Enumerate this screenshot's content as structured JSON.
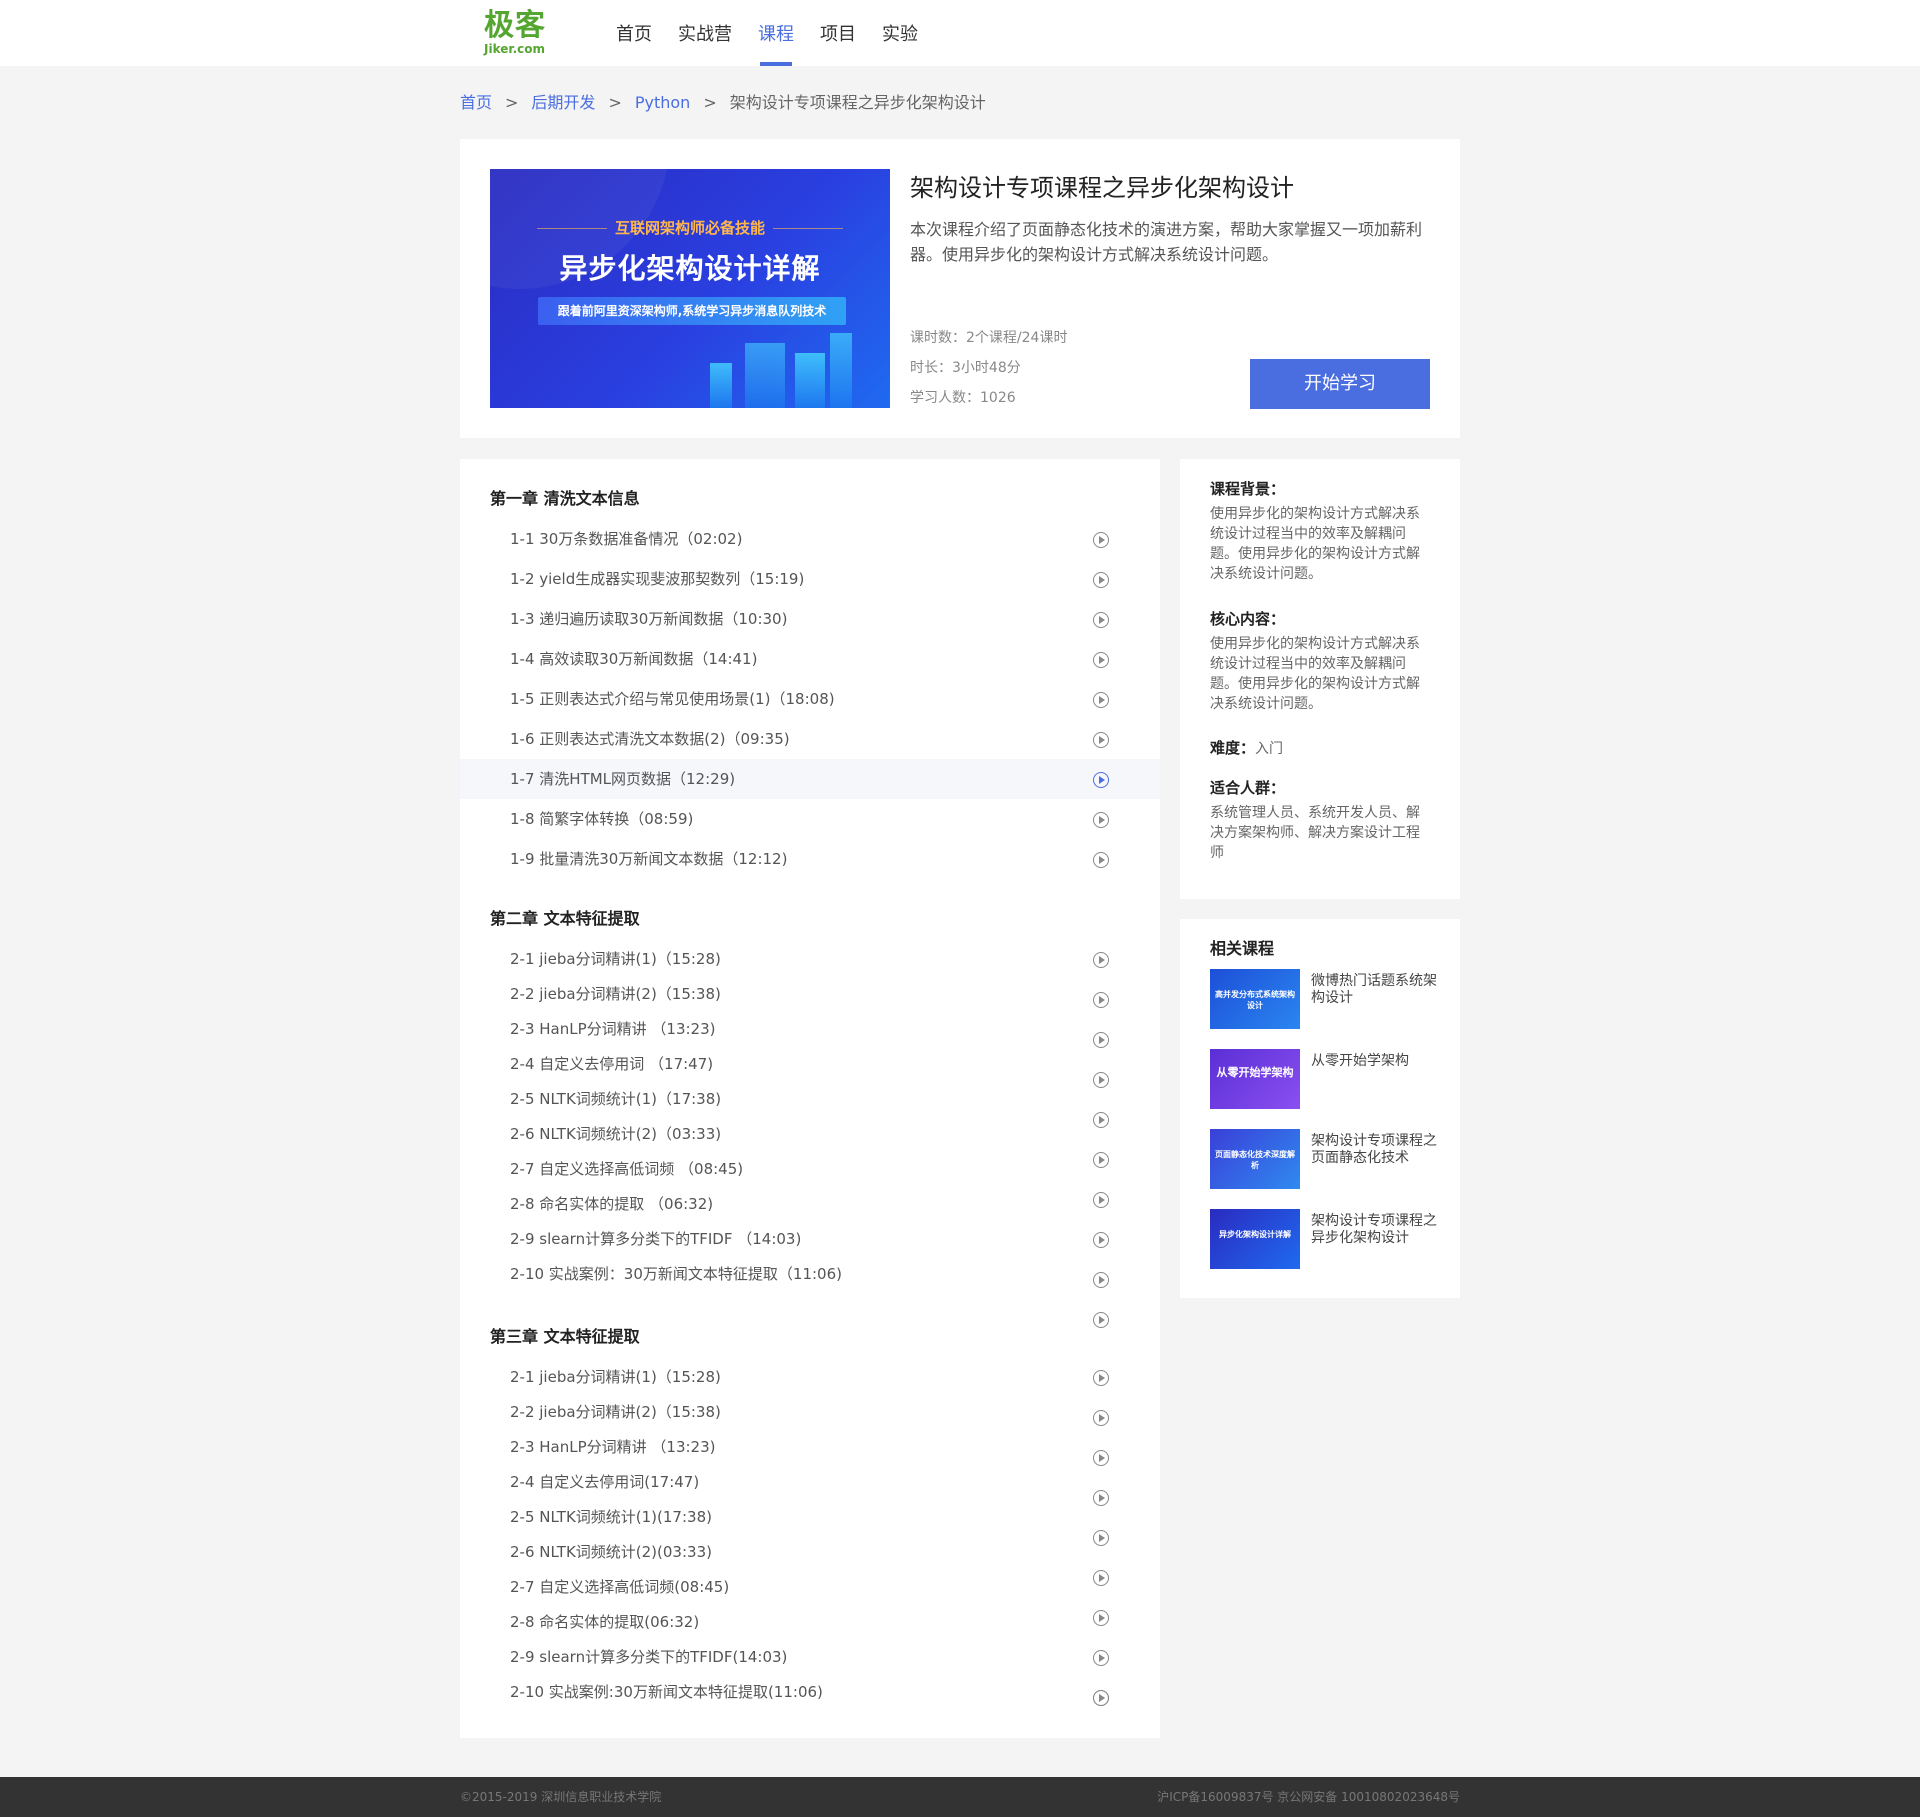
{
  "logo": {
    "cn": "极客",
    "en": "Jiker.com"
  },
  "nav": [
    "首页",
    "实战营",
    "课程",
    "项目",
    "实验"
  ],
  "breadcrumb": {
    "items": [
      "首页",
      "后期开发",
      "Python"
    ],
    "separator": ">",
    "current": "架构设计专项课程之异步化架构设计"
  },
  "course": {
    "cover_top": "互联网架构师必备技能",
    "cover_title": "异步化架构设计详解",
    "cover_sub": "跟着前阿里资深架构师,系统学习异步消息队列技术",
    "title": "架构设计专项课程之异步化架构设计",
    "desc": "本次课程介绍了页面静态化技术的演进方案，帮助大家掌握又一项加薪利器。使用异步化的架构设计方式解决系统设计问题。",
    "hours": "课时数：2个课程/24课时",
    "duration": "时长：3小时48分",
    "students": "学习人数：1026",
    "start_label": "开始学习"
  },
  "chapters": [
    {
      "title": "第一章 清洗文本信息",
      "lessons": [
        "1-1 30万条数据准备情况（02:02)",
        "1-2 yield生成器实现斐波那契数列（15:19)",
        "1-3 递归遍历读取30万新闻数据（10:30)",
        "1-4 高效读取30万新闻数据（14:41)",
        "1-5 正则表达式介绍与常见使用场景(1)（18:08)",
        "1-6 正则表达式清洗文本数据(2)（09:35)",
        "1-7 清洗HTML网页数据（12:29)",
        "1-8 简繁字体转换（08:59)",
        "1-9 批量清洗30万新闻文本数据（12:12)"
      ]
    },
    {
      "title": "第二章 文本特征提取",
      "lessons": [
        "2-1 jieba分词精讲(1)（15:28)",
        "2-2 jieba分词精讲(2)（15:38)",
        "2-3 HanLP分词精讲 （13:23)",
        "2-4 自定义去停用词 （17:47)",
        "2-5 NLTK词频统计(1)（17:38)",
        "2-6 NLTK词频统计(2)（03:33)",
        "2-7 自定义选择高低词频 （08:45)",
        "2-8 命名实体的提取 （06:32)",
        "2-9 slearn计算多分类下的TFIDF （14:03)",
        "2-10 实战案例：30万新闻文本特征提取（11:06)"
      ]
    },
    {
      "title": "第三章 文本特征提取",
      "lessons": [
        "2-1 jieba分词精讲(1)（15:28)",
        "2-2 jieba分词精讲(2)（15:38)",
        "2-3 HanLP分词精讲 （13:23)",
        "2-4 自定义去停用词(17:47)",
        "2-5 NLTK词频统计(1)(17:38)",
        "2-6 NLTK词频统计(2)(03:33)",
        "2-7 自定义选择高低词频(08:45)",
        "2-8 命名实体的提取(06:32)",
        "2-9 slearn计算多分类下的TFIDF(14:03)",
        "2-10 实战案例:30万新闻文本特征提取(11:06)"
      ]
    }
  ],
  "side": {
    "background_title": "课程背景：",
    "background_text": "使用异步化的架构设计方式解决系统设计过程当中的效率及解耦问题。使用异步化的架构设计方式解决系统设计问题。",
    "core_title": "核心内容：",
    "core_text": "使用异步化的架构设计方式解决系统设计过程当中的效率及解耦问题。使用异步化的架构设计方式解决系统设计问题。",
    "difficulty_label": "难度：",
    "difficulty_value": "入门",
    "audience_title": "适合人群：",
    "audience_text": "系统管理人员、系统开发人员、解决方案架构师、解决方案设计工程师"
  },
  "related": {
    "title": "相关课程",
    "items": [
      {
        "name": "微博热门话题系统架构设计",
        "thumb_text": "高并发分布式系统架构设计"
      },
      {
        "name": "从零开始学架构",
        "thumb_text": "从零开始学架构"
      },
      {
        "name": "架构设计专项课程之页面静态化技术",
        "thumb_text": "页面静态化技术深度解析"
      },
      {
        "name": "架构设计专项课程之异步化架构设计",
        "thumb_text": "异步化架构设计详解"
      }
    ]
  },
  "footer": {
    "left": "©2015-2019 深圳信息职业技术学院",
    "right": "沪ICP备16009837号 京公网安备 10010802023648号"
  },
  "colors": {
    "accent": "#4a6ee0",
    "logo": "#55a630"
  }
}
